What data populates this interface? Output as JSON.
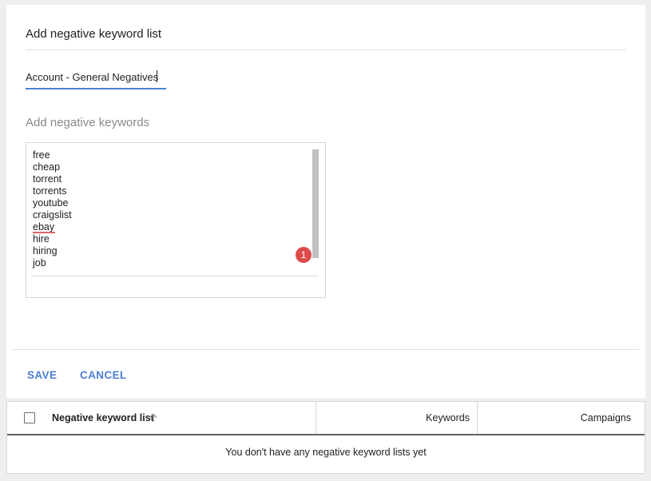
{
  "form": {
    "title": "Add negative keyword list",
    "list_name_value": "Account - General Negatives",
    "keywords_label": "Add negative keywords",
    "keywords": [
      "free",
      "cheap",
      "torrent",
      "torrents",
      "youtube",
      "craigslist",
      "ebay",
      "hire",
      "hiring",
      "job"
    ],
    "error_count": "1"
  },
  "actions": {
    "save_label": "SAVE",
    "cancel_label": "CANCEL"
  },
  "table": {
    "columns": {
      "name": "Negative keyword list",
      "keywords": "Keywords",
      "campaigns": "Campaigns"
    },
    "sort_icon": "arrow-up-icon",
    "empty_message": "You don't have any negative keyword lists yet"
  },
  "colors": {
    "accent": "#4a7fd6",
    "error": "#dd4b4b"
  }
}
